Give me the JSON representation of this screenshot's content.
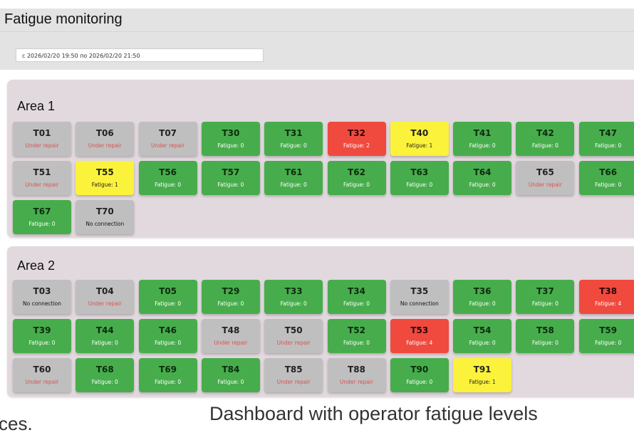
{
  "header": {
    "title": "Fatigue monitoring",
    "date_range": "c 2026/02/20 19:50 по 2026/02/20 21:50"
  },
  "areas": [
    {
      "title": "Area 1",
      "terminals": [
        {
          "name": "T01",
          "status": "Under repair",
          "state": "repair"
        },
        {
          "name": "T06",
          "status": "Under repair",
          "state": "repair"
        },
        {
          "name": "T07",
          "status": "Under repair",
          "state": "repair"
        },
        {
          "name": "T30",
          "status": "Fatigue: 0",
          "state": "ok"
        },
        {
          "name": "T31",
          "status": "Fatigue: 0",
          "state": "ok"
        },
        {
          "name": "T32",
          "status": "Fatigue: 2",
          "state": "high"
        },
        {
          "name": "T40",
          "status": "Fatigue: 1",
          "state": "medium"
        },
        {
          "name": "T41",
          "status": "Fatigue: 0",
          "state": "ok"
        },
        {
          "name": "T42",
          "status": "Fatigue: 0",
          "state": "ok"
        },
        {
          "name": "T47",
          "status": "Fatigue: 0",
          "state": "ok"
        },
        {
          "name": "T51",
          "status": "Under repair",
          "state": "repair"
        },
        {
          "name": "T55",
          "status": "Fatigue: 1",
          "state": "medium"
        },
        {
          "name": "T56",
          "status": "Fatigue: 0",
          "state": "ok"
        },
        {
          "name": "T57",
          "status": "Fatigue: 0",
          "state": "ok"
        },
        {
          "name": "T61",
          "status": "Fatigue: 0",
          "state": "ok"
        },
        {
          "name": "T62",
          "status": "Fatigue: 0",
          "state": "ok"
        },
        {
          "name": "T63",
          "status": "Fatigue: 0",
          "state": "ok"
        },
        {
          "name": "T64",
          "status": "Fatigue: 0",
          "state": "ok"
        },
        {
          "name": "T65",
          "status": "Under repair",
          "state": "repair"
        },
        {
          "name": "T66",
          "status": "Fatigue: 0",
          "state": "ok"
        },
        {
          "name": "T67",
          "status": "Fatigue: 0",
          "state": "ok"
        },
        {
          "name": "T70",
          "status": "No connection",
          "state": "noconn"
        }
      ]
    },
    {
      "title": "Area 2",
      "terminals": [
        {
          "name": "T03",
          "status": "No connection",
          "state": "noconn"
        },
        {
          "name": "T04",
          "status": "Under repair",
          "state": "repair"
        },
        {
          "name": "T05",
          "status": "Fatigue: 0",
          "state": "ok"
        },
        {
          "name": "T29",
          "status": "Fatigue: 0",
          "state": "ok"
        },
        {
          "name": "T33",
          "status": "Fatigue: 0",
          "state": "ok"
        },
        {
          "name": "T34",
          "status": "Fatigue: 0",
          "state": "ok"
        },
        {
          "name": "T35",
          "status": "No connection",
          "state": "noconn"
        },
        {
          "name": "T36",
          "status": "Fatigue: 0",
          "state": "ok"
        },
        {
          "name": "T37",
          "status": "Fatigue: 0",
          "state": "ok"
        },
        {
          "name": "T38",
          "status": "Fatigue: 4",
          "state": "high"
        },
        {
          "name": "T39",
          "status": "Fatigue: 0",
          "state": "ok"
        },
        {
          "name": "T44",
          "status": "Fatigue: 0",
          "state": "ok"
        },
        {
          "name": "T46",
          "status": "Fatigue: 0",
          "state": "ok"
        },
        {
          "name": "T48",
          "status": "Under repair",
          "state": "repair"
        },
        {
          "name": "T50",
          "status": "Under repair",
          "state": "repair"
        },
        {
          "name": "T52",
          "status": "Fatigue: 0",
          "state": "ok"
        },
        {
          "name": "T53",
          "status": "Fatigue: 4",
          "state": "high"
        },
        {
          "name": "T54",
          "status": "Fatigue: 0",
          "state": "ok"
        },
        {
          "name": "T58",
          "status": "Fatigue: 0",
          "state": "ok"
        },
        {
          "name": "T59",
          "status": "Fatigue: 0",
          "state": "ok"
        },
        {
          "name": "T60",
          "status": "Under repair",
          "state": "repair"
        },
        {
          "name": "T68",
          "status": "Fatigue: 0",
          "state": "ok"
        },
        {
          "name": "T69",
          "status": "Fatigue: 0",
          "state": "ok"
        },
        {
          "name": "T84",
          "status": "Fatigue: 0",
          "state": "ok"
        },
        {
          "name": "T85",
          "status": "Under repair",
          "state": "repair"
        },
        {
          "name": "T88",
          "status": "Under repair",
          "state": "repair"
        },
        {
          "name": "T90",
          "status": "Fatigue: 0",
          "state": "ok"
        },
        {
          "name": "T91",
          "status": "Fatigue: 1",
          "state": "medium"
        }
      ]
    }
  ],
  "colors": {
    "ok": "#47ad4c",
    "medium": "#fbf23b",
    "high": "#f04a3f",
    "inactive": "#bfbfbf",
    "repair_text": "#e05050",
    "area_bg": "#e2d9de"
  },
  "caption": {
    "left_fragment": "ces.",
    "text": "Dashboard with operator fatigue levels"
  }
}
